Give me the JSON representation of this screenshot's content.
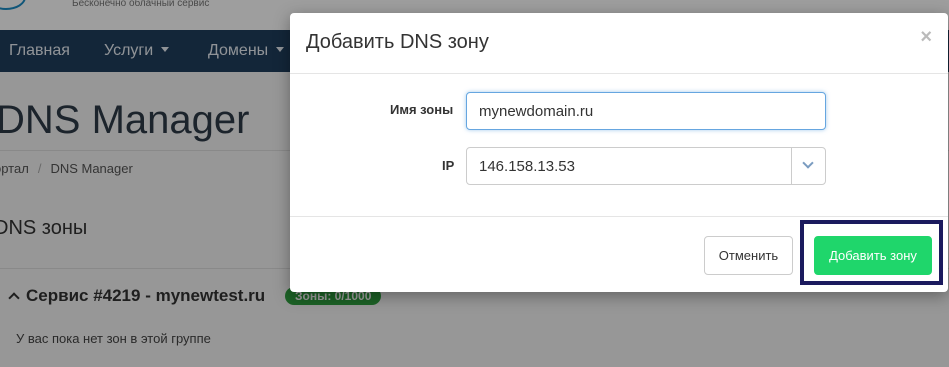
{
  "site": {
    "tagline": "Бесконечно облачный сервис"
  },
  "nav": {
    "items": [
      {
        "label": "Главная"
      },
      {
        "label": "Услуги"
      },
      {
        "label": "Домены"
      }
    ]
  },
  "page": {
    "title": "DNS Manager",
    "breadcrumb": [
      "ортал",
      "DNS Manager"
    ],
    "section_title": "DNS зоны",
    "group": {
      "title": "Сервис #4219 - mynewtest.ru",
      "badge": "Зоны: 0/1000",
      "empty_text": "У вас пока нет зон в этой группе"
    }
  },
  "modal": {
    "title": "Добавить DNS зону",
    "close_glyph": "×",
    "fields": {
      "zone_name": {
        "label": "Имя зоны",
        "value": "mynewdomain.ru"
      },
      "ip": {
        "label": "IP",
        "value": "146.158.13.53"
      }
    },
    "buttons": {
      "cancel": "Отменить",
      "submit": "Добавить зону"
    }
  },
  "colors": {
    "navbar": "#1f3e5d",
    "submit": "#1fd66b",
    "badge": "#2e9e3e",
    "highlight": "#1b1a5e"
  },
  "icons": {
    "logo": "cloud-logo-icon",
    "nav_caret": "caret-down-icon",
    "group_toggle": "chevron-up-icon",
    "select_arrow": "chevron-down-icon",
    "close": "close-icon"
  }
}
